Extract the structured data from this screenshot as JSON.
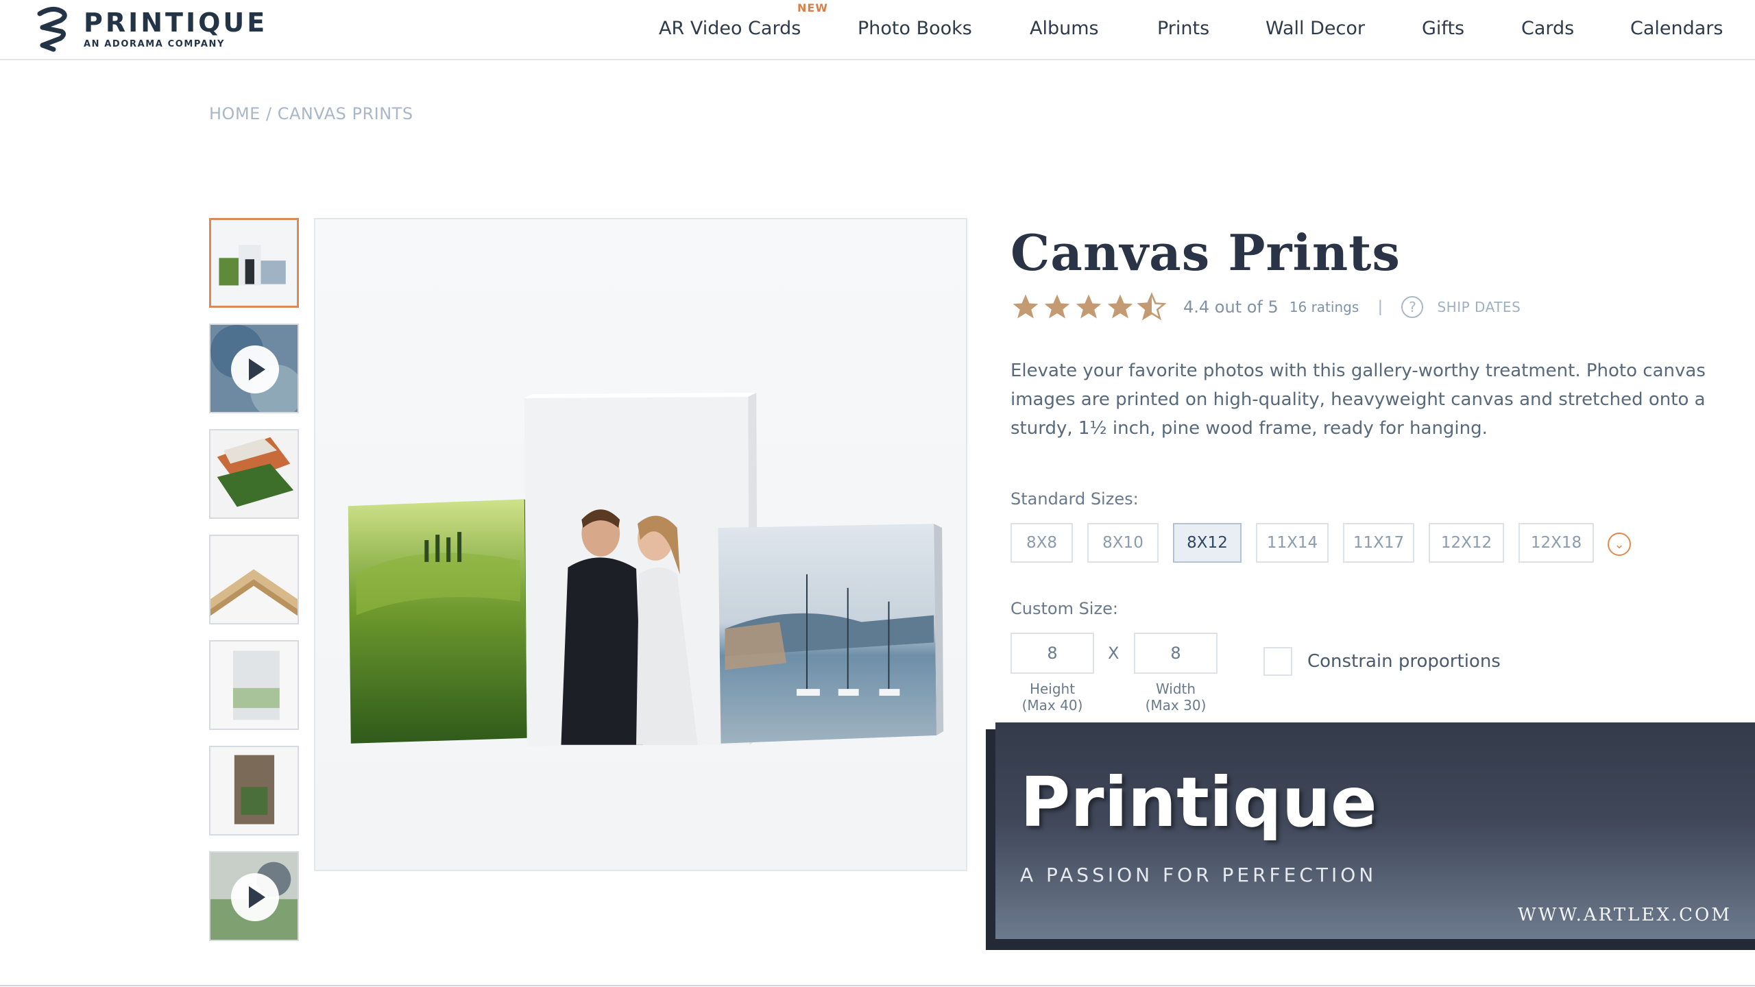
{
  "header": {
    "logo_name": "PRINTIQUE",
    "logo_sub": "AN ADORAMA COMPANY",
    "new_badge": "NEW",
    "nav": [
      "AR Video Cards",
      "Photo Books",
      "Albums",
      "Prints",
      "Wall Decor",
      "Gifts",
      "Cards",
      "Calendars"
    ]
  },
  "breadcrumb": {
    "home": "HOME",
    "separator": "/",
    "current": "CANVAS PRINTS"
  },
  "gallery": {
    "thumbnails": [
      {
        "kind": "image",
        "active": true
      },
      {
        "kind": "video",
        "active": false
      },
      {
        "kind": "image",
        "active": false
      },
      {
        "kind": "image",
        "active": false
      },
      {
        "kind": "image",
        "active": false
      },
      {
        "kind": "image",
        "active": false
      },
      {
        "kind": "video",
        "active": false
      }
    ]
  },
  "product": {
    "title": "Canvas Prints",
    "rating_value": 4.4,
    "rating_text": "4.4 out of 5",
    "ratings_count": "16 ratings",
    "separator": "|",
    "help_icon_glyph": "?",
    "ship_dates": "SHIP DATES",
    "description": "Elevate your favorite photos with this gallery-worthy treatment. Photo canvas images are printed on high-quality, heavyweight canvas and stretched onto a sturdy, 1½ inch, pine wood frame, ready for hanging.",
    "standard_sizes_label": "Standard Sizes:",
    "sizes": [
      "8X8",
      "8X10",
      "8X12",
      "11X14",
      "11X17",
      "12X12",
      "12X18"
    ],
    "selected_size": "8X12",
    "custom_size_label": "Custom Size:",
    "height_value": "8",
    "width_value": "8",
    "dim_separator": "X",
    "height_caption": "Height",
    "height_max": "(Max 40)",
    "width_caption": "Width",
    "width_max": "(Max 30)",
    "constrain_label": "Constrain proportions"
  },
  "banner": {
    "title": "Printique",
    "tagline": "A PASSION FOR PERFECTION",
    "url": "WWW.ARTLEX.COM"
  },
  "colors": {
    "accent_orange": "#e08a4e",
    "brand_navy": "#243447",
    "star_fill": "#c49a72",
    "muted_text": "#7f93a8"
  },
  "icons": [
    "logo-icon",
    "star-icon",
    "help-icon",
    "chevron-down-icon",
    "play-icon"
  ]
}
